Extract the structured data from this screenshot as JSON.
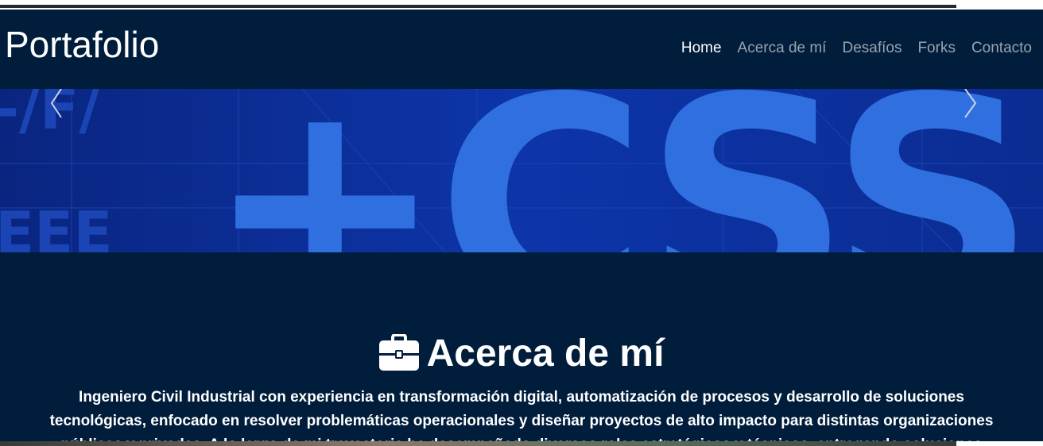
{
  "navbar": {
    "brand": "Portafolio",
    "links": [
      "Home",
      "Acerca de mí",
      "Desafíos",
      "Forks",
      "Contacto"
    ]
  },
  "hero": {
    "banner_text": "+CSS",
    "prev_icon": "chevron-left-icon",
    "next_icon": "chevron-right-icon"
  },
  "about": {
    "icon": "briefcase-icon",
    "title": "Acerca de mí",
    "text": "Ingeniero Civil Industrial con experiencia en transformación digital, automatización de procesos y desarrollo de soluciones tecnológicas, enfocado en resolver problemáticas operacionales y diseñar proyectos de alto impacto para distintas organizaciones públicas y privadas. A lo largo de mi trayectoria he desempeñado diversos roles estratégicos y técnicos, entregando soluciones digitales"
  },
  "colors": {
    "navbar_bg": "#001d3b",
    "active_link": "#ffffff",
    "inactive_link": "#9aa3ad",
    "hero_blue": "#2f6fe0"
  }
}
